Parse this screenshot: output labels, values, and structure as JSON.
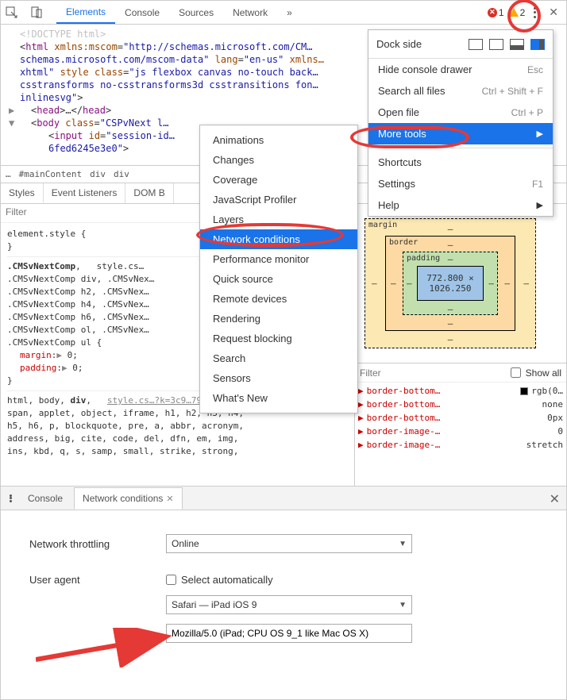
{
  "toolbar": {
    "tabs": [
      "Elements",
      "Console",
      "Sources",
      "Network"
    ],
    "overflow": "»",
    "active": 0,
    "error_count": "1",
    "warn_count": "2"
  },
  "code": {
    "doctype": "<!DOCTYPE html>",
    "html_open": "html",
    "html_attrs": [
      {
        "n": "xmlns:mscom",
        "v": "\"http://schemas.microsoft.com/CM…"
      },
      {
        "n": "",
        "v": "schemas.microsoft.com/mscom-data\""
      },
      {
        "n": "lang",
        "v": "\"en-us\""
      },
      {
        "n": "xmlns…",
        "v": ""
      }
    ],
    "html_line2_suffix": "xhtml\"",
    "style_class_attr": "style class",
    "style_class_val": "\"js flexbox canvas no-touch back…",
    "line3": "csstransforms no-csstransforms3d csstransitions fon…",
    "line4": "inlinesvg\"",
    "head": "head",
    "body_tag": "body",
    "body_class_attr": "class",
    "body_class_val": "\"CSPvNext l…",
    "input_tag": "input",
    "input_id_attr": "id",
    "input_id_val": "\"session-id…",
    "input_val": "6fed6245e3e0\""
  },
  "breadcrumb": [
    "…",
    "#mainContent",
    "div",
    "div"
  ],
  "subtabs": [
    "Styles",
    "Event Listeners",
    "DOM B"
  ],
  "styles_left": {
    "filter_placeholder": "Filter",
    "block1_selector": "element.style",
    "open": "{",
    "close": "}",
    "block2_main": ".CMSvNextComp",
    "block2_link": "style.cs…",
    "block2_lines": [
      ".CMSvNextComp div, .CMSvNex…",
      ".CMSvNextComp h2, .CMSvNex…",
      ".CMSvNextComp h4, .CMSvNex…",
      ".CMSvNextComp h6, .CMSvNex…",
      ".CMSvNextComp ol, .CMSvNex…",
      ".CMSvNextComp ul {"
    ],
    "props": [
      {
        "n": "margin",
        "v": "0;"
      },
      {
        "n": "padding",
        "v": "0;"
      }
    ],
    "block3_line1_a": "html, body, ",
    "block3_line1_b": "div",
    "block3_link": "style.cs…?k=3c9…794e5ae84ce1:1",
    "block3_lines": [
      "span, applet, object, iframe, h1, h2, h3, h4,",
      "h5, h6, p, blockquote, pre, a, abbr, acronym,",
      "address, big, cite, code, del, dfn, em, img,",
      "ins, kbd, q, s, samp, small, strike, strong,"
    ]
  },
  "boxmodel": {
    "margin": "margin",
    "border": "border",
    "padding": "padding",
    "content": "772.800 × 1026.250",
    "dash": "–"
  },
  "computed": {
    "filter_placeholder": "Filter",
    "showall": "Show all",
    "rows": [
      {
        "name": "border-bottom…",
        "val": "rgb(0…",
        "swatch": "#000"
      },
      {
        "name": "border-bottom…",
        "val": "none"
      },
      {
        "name": "border-bottom…",
        "val": "0px"
      },
      {
        "name": "border-image-…",
        "val": "0"
      },
      {
        "name": "border-image-…",
        "val": "stretch"
      }
    ]
  },
  "main_menu": {
    "dock_label": "Dock side",
    "items1": [
      {
        "label": "Hide console drawer",
        "sc": "Esc"
      },
      {
        "label": "Search all files",
        "sc": "Ctrl + Shift + F"
      },
      {
        "label": "Open file",
        "sc": "Ctrl + P"
      },
      {
        "label": "More tools",
        "sub": true,
        "hl": true
      }
    ],
    "items2": [
      {
        "label": "Shortcuts",
        "sc": ""
      },
      {
        "label": "Settings",
        "sc": "F1"
      },
      {
        "label": "Help",
        "sub": true
      }
    ]
  },
  "submenu": {
    "items": [
      "Animations",
      "Changes",
      "Coverage",
      "JavaScript Profiler",
      "Layers",
      "Network conditions",
      "Performance monitor",
      "Quick source",
      "Remote devices",
      "Rendering",
      "Request blocking",
      "Search",
      "Sensors",
      "What's New"
    ],
    "hl_index": 5
  },
  "drawer": {
    "tabs": [
      "Console",
      "Network conditions"
    ],
    "active": 1,
    "throttle_label": "Network throttling",
    "throttle_value": "Online",
    "ua_label": "User agent",
    "ua_auto": "Select automatically",
    "ua_value": "Safari — iPad iOS 9",
    "ua_string": "Mozilla/5.0 (iPad; CPU OS 9_1 like Mac OS X)"
  }
}
